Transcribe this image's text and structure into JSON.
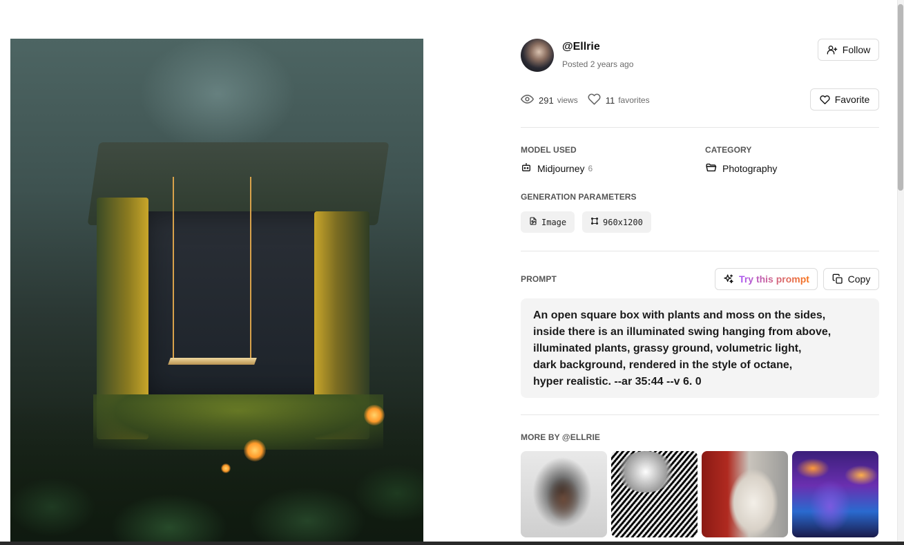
{
  "artwork": {
    "image_icon": "generated-artwork-image"
  },
  "author": {
    "username": "@Ellrie",
    "posted": "Posted 2 years ago",
    "follow_label": "Follow"
  },
  "stats": {
    "views_count": "291",
    "views_label": "views",
    "favorites_count": "11",
    "favorites_label": "favorites",
    "favorite_button_label": "Favorite"
  },
  "meta": {
    "model_label": "MODEL USED",
    "model_value": "Midjourney",
    "model_version": "6",
    "category_label": "CATEGORY",
    "category_value": "Photography",
    "params_label": "GENERATION PARAMETERS",
    "params": [
      {
        "label": "Image",
        "icon": "file-image-icon"
      },
      {
        "label": "960x1200",
        "icon": "dimensions-icon"
      }
    ]
  },
  "prompt": {
    "label": "PROMPT",
    "try_label": "Try this prompt",
    "copy_label": "Copy",
    "text": "An open square box with plants and moss on the sides,\ninside there is an illuminated swing hanging from above,\nilluminated plants, grassy ground, volumetric light,\ndark background, rendered in the style of octane,\nhyper realistic. --ar 35:44 --v 6. 0"
  },
  "more_by": {
    "label": "MORE BY @ELLRIE"
  },
  "colors": {
    "accent_gradient_start": "#a855f7",
    "accent_gradient_end": "#f97316",
    "chip_bg": "#f1f1f1",
    "prompt_bg": "#f4f4f4"
  }
}
